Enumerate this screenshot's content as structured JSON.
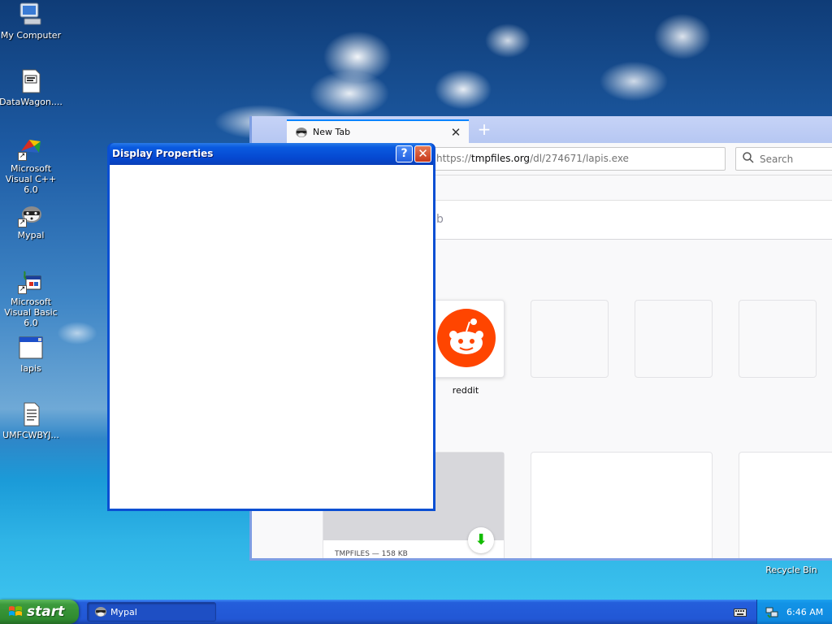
{
  "desktop": {
    "icons": [
      {
        "label": "My Computer",
        "icon": "computer-icon"
      },
      {
        "label": "DataWagon....",
        "icon": "text-file-icon"
      },
      {
        "label": "Microsoft Visual C++ 6.0",
        "icon": "visual-cpp-icon"
      },
      {
        "label": "Mypal",
        "icon": "mypal-icon"
      },
      {
        "label": "Microsoft Visual Basic 6.0",
        "icon": "visual-basic-icon"
      },
      {
        "label": "lapis",
        "icon": "application-window-icon"
      },
      {
        "label": "UMFCWBYJ...",
        "icon": "document-icon"
      }
    ],
    "recycle_bin_label": "Recycle Bin"
  },
  "browser": {
    "tab_title": "New Tab",
    "url_prefix": "https://",
    "url_domain": "tmpfiles.org",
    "url_path": "/dl/274671/lapis.exe",
    "search_placeholder": "Search",
    "page_search_fragment": "b",
    "top_sites": [
      {
        "label": "reddit",
        "icon": "reddit-icon"
      },
      {
        "label": ""
      },
      {
        "label": ""
      },
      {
        "label": ""
      }
    ],
    "highlight": {
      "meta": "TMPFILES — 158 KB",
      "icon": "download-icon"
    }
  },
  "dialog": {
    "title": "Display Properties",
    "help_label": "?",
    "close_label": "✕"
  },
  "taskbar": {
    "start_label": "start",
    "task_label": "Mypal",
    "clock": "6:46 AM"
  },
  "colors": {
    "xp_title_blue": "#0a4fd3",
    "start_green": "#3c9a3c",
    "reddit_orange": "#ff4500",
    "download_green": "#12bc00"
  }
}
